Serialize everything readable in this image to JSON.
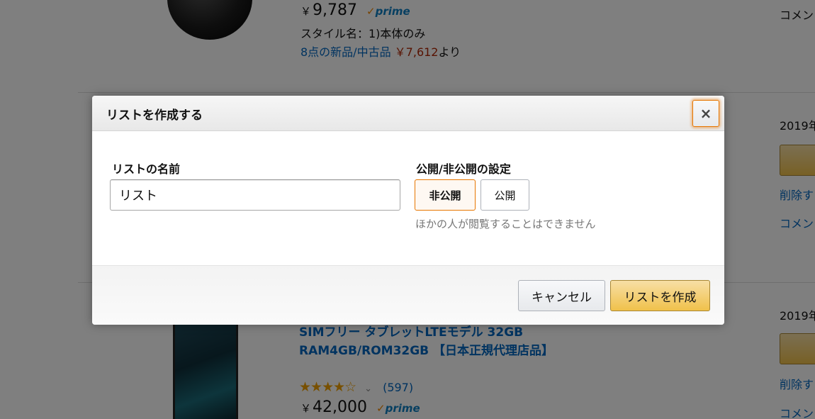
{
  "background": {
    "item1": {
      "price_yen": "￥",
      "price": "9,787",
      "prime_check": "✓",
      "prime_label": "prime",
      "style": "スタイル名：1)本体のみ",
      "offers_link": "8点の新品/中古品",
      "offers_price": "￥7,612",
      "offers_suffix": "より"
    },
    "item2": {
      "title": "SIMフリー タブレットLTEモデル 32GB RAM4GB/ROM32GB 【日本正規代理店品】",
      "stars": "★★★★☆",
      "stars_value": 4,
      "chevron": "⌄",
      "reviews": "(597)",
      "price_yen": "￥",
      "price": "42,000",
      "prime_check": "✓",
      "prime_label": "prime"
    },
    "side": {
      "comment1": "コメン",
      "date1": "2019年",
      "delete1": "削除す",
      "comment2": "コメン",
      "date2": "2019年",
      "delete2": "削除す",
      "comment3": "コメン"
    }
  },
  "dialog": {
    "title": "リストを作成する",
    "close_icon": "×",
    "name_label": "リストの名前",
    "name_value": "リスト",
    "privacy_label": "公開/非公開の設定",
    "private_option": "非公開",
    "public_option": "公開",
    "selected_option": "非公開",
    "privacy_hint": "ほかの人が閲覧することはできません",
    "cancel_label": "キャンセル",
    "create_label": "リストを作成"
  },
  "colors": {
    "overlay": "rgba(0,0,0,0.5)",
    "accent_orange": "#e77600",
    "primary_button": "#f0c14b",
    "link": "#0066c0",
    "price_red": "#b12704"
  }
}
